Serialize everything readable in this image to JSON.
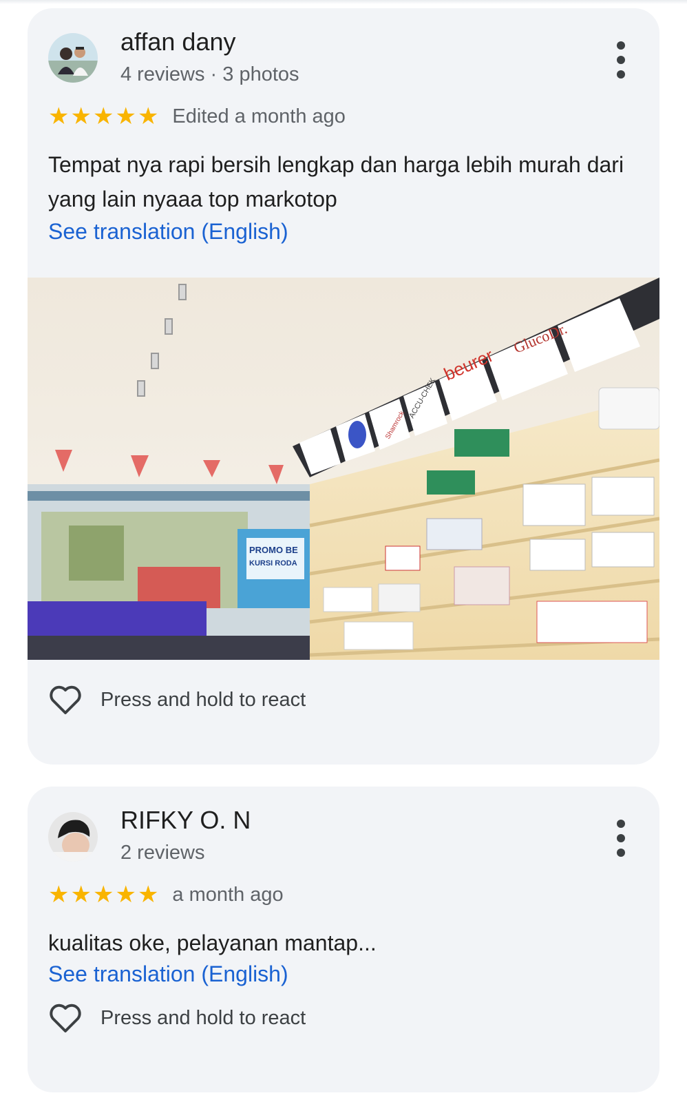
{
  "reviews": [
    {
      "author": "affan dany",
      "meta": "4 reviews · 3 photos",
      "rating": 5,
      "date": "Edited a month ago",
      "text": "Tempat nya rapi bersih lengkap dan harga lebih murah dari yang lain nyaaa top markotop",
      "translate_label": "See translation (English)",
      "photo": {
        "signs": [
          "beurer",
          "ACCU-CHEK",
          "Shamrock",
          "SENSI",
          "GlucoDr."
        ],
        "banner": "PROMO BE\nKURSI RODA"
      },
      "react_label": "Press and hold to react"
    },
    {
      "author": "RIFKY O. N",
      "meta": "2 reviews",
      "rating": 5,
      "date": "a month ago",
      "text": "kualitas oke, pelayanan mantap...",
      "translate_label": "See translation (English)",
      "react_label": "Press and hold to react"
    }
  ],
  "icons": {
    "star": "star-icon",
    "more": "more-vert-icon",
    "heart": "heart-outline-icon"
  },
  "colors": {
    "star": "#f9b400",
    "link": "#1a62d2",
    "card_bg": "#f2f4f7"
  }
}
